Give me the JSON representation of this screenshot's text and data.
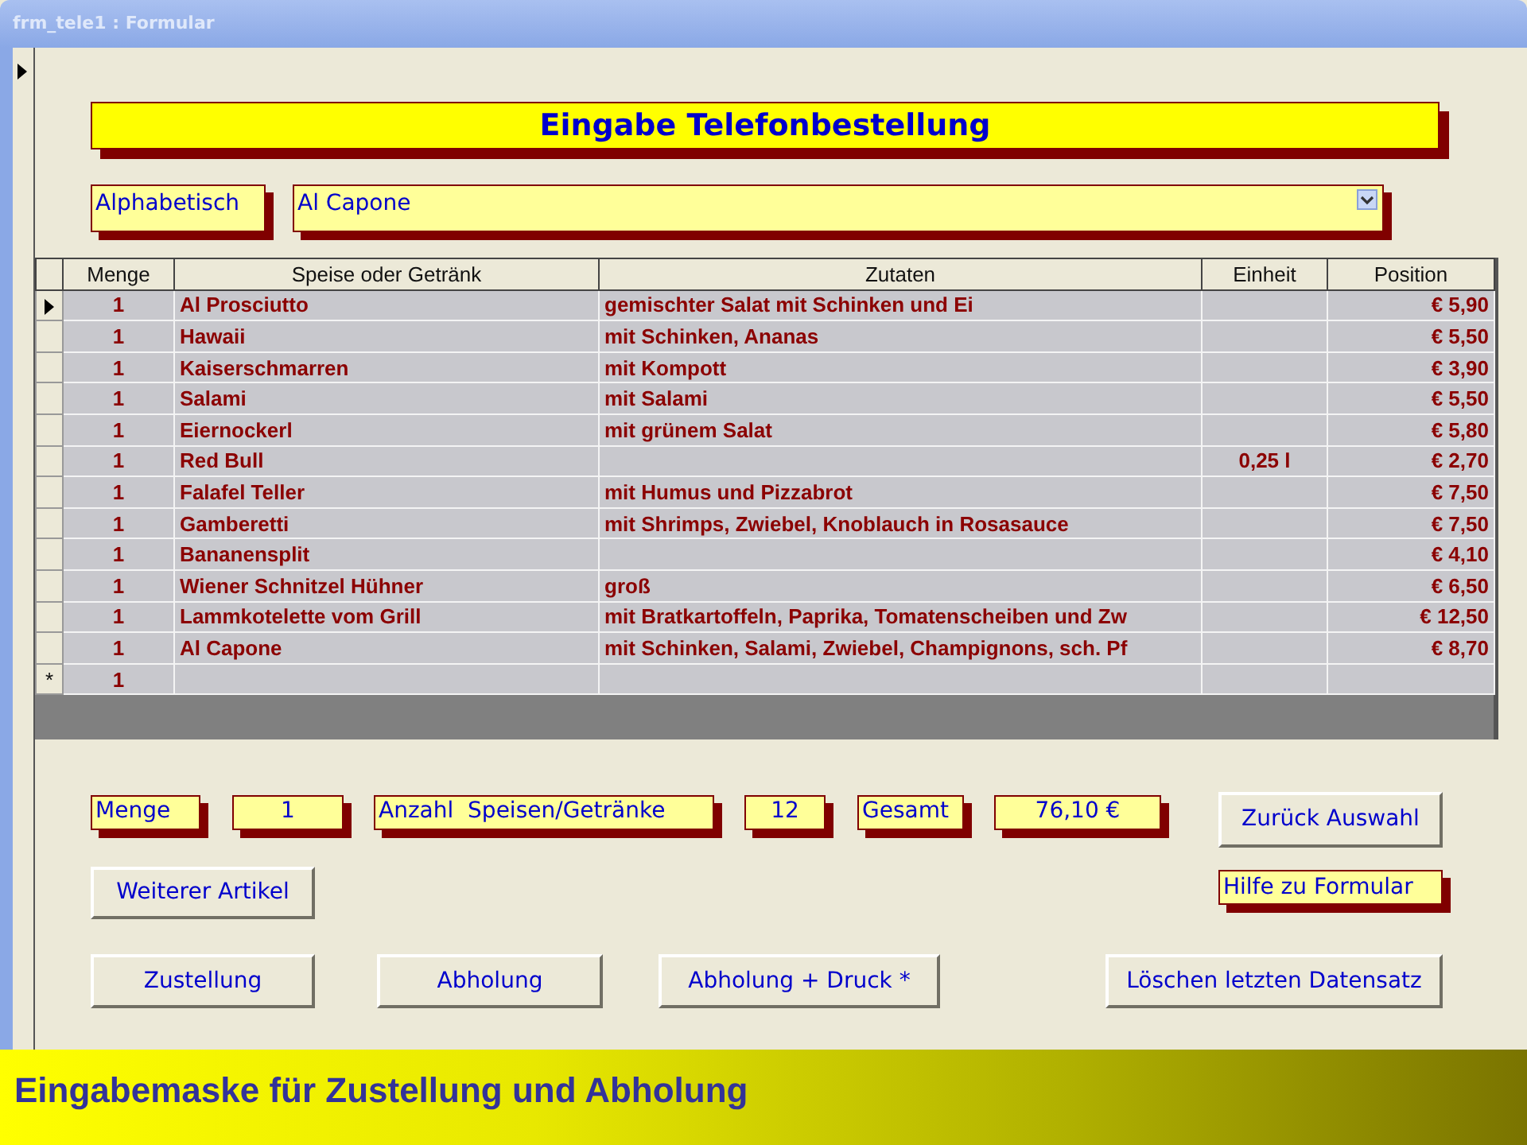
{
  "window": {
    "title": "frm_tele1 : Formular"
  },
  "heading": "Eingabe Telefonbestellung",
  "sort_label": "Alphabetisch",
  "dish_combo": {
    "value": "Al Capone"
  },
  "table": {
    "columns": [
      "Menge",
      "Speise oder Getränk",
      "Zutaten",
      "Einheit",
      "Position"
    ],
    "rows": [
      {
        "selected": true,
        "cells": [
          "1",
          "Al Prosciutto",
          "gemischter Salat mit Schinken und Ei",
          "",
          "€ 5,90"
        ]
      },
      {
        "selected": false,
        "cells": [
          "1",
          "Hawaii",
          "mit Schinken, Ananas",
          "",
          "€ 5,50"
        ]
      },
      {
        "selected": false,
        "cells": [
          "1",
          "Kaiserschmarren",
          "mit Kompott",
          "",
          "€ 3,90"
        ]
      },
      {
        "selected": false,
        "cells": [
          "1",
          "Salami",
          "mit Salami",
          "",
          "€ 5,50"
        ]
      },
      {
        "selected": false,
        "cells": [
          "1",
          "Eiernockerl",
          "mit grünem Salat",
          "",
          "€ 5,80"
        ]
      },
      {
        "selected": false,
        "cells": [
          "1",
          "Red Bull",
          "",
          "0,25 l",
          "€ 2,70"
        ]
      },
      {
        "selected": false,
        "cells": [
          "1",
          "Falafel Teller",
          "mit Humus und Pizzabrot",
          "",
          "€ 7,50"
        ]
      },
      {
        "selected": false,
        "cells": [
          "1",
          "Gamberetti",
          "mit Shrimps, Zwiebel, Knoblauch in Rosasauce",
          "",
          "€ 7,50"
        ]
      },
      {
        "selected": false,
        "cells": [
          "1",
          "Bananensplit",
          "",
          "",
          "€ 4,10"
        ]
      },
      {
        "selected": false,
        "cells": [
          "1",
          "Wiener Schnitzel Hühner",
          "groß",
          "",
          "€ 6,50"
        ]
      },
      {
        "selected": false,
        "cells": [
          "1",
          "Lammkotelette vom Grill",
          "mit Bratkartoffeln, Paprika, Tomatenscheiben und Zw",
          "",
          "€ 12,50"
        ]
      },
      {
        "selected": false,
        "cells": [
          "1",
          "Al Capone",
          "mit Schinken, Salami, Zwiebel, Champignons, sch. Pf",
          "",
          "€ 8,70"
        ]
      }
    ],
    "new_row": {
      "marker": "*",
      "cells": [
        "1",
        "",
        "",
        "",
        ""
      ]
    }
  },
  "summary": [
    {
      "label": "Menge",
      "value": "1"
    },
    {
      "label": "Anzahl  Speisen/Getränke",
      "value": "12"
    },
    {
      "label": "Gesamt",
      "value": "76,10 €"
    }
  ],
  "buttons": [
    {
      "kind": "button",
      "label": "Zurück Auswahl"
    },
    {
      "kind": "button",
      "label": "Weiterer Artikel"
    },
    {
      "kind": "tag",
      "label": "Hilfe zu Formular"
    },
    {
      "kind": "button",
      "label": "Zustellung"
    },
    {
      "kind": "button",
      "label": "Abholung"
    },
    {
      "kind": "button",
      "label": "Abholung + Druck *"
    },
    {
      "kind": "button",
      "label": "Löschen letzten Datensatz"
    }
  ],
  "caption": "Eingabemaske für Zustellung und Abholung"
}
